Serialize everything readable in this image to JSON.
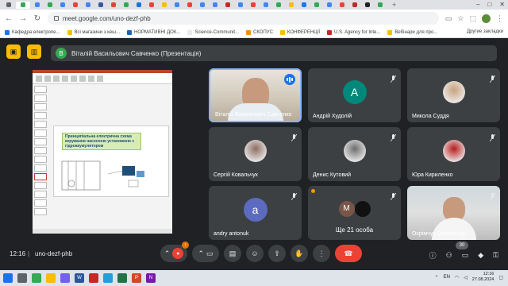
{
  "browser": {
    "url": "meet.google.com/uno-dezf-phb",
    "tab_colors": [
      "#5f6368",
      "#34a853",
      "#4285f4",
      "#34a853",
      "#4285f4",
      "#ea4335",
      "#4285f4",
      "#3b5998",
      "#ea4335",
      "#34a853",
      "#1a73e8",
      "#ea4335",
      "#fbbc04",
      "#4285f4",
      "#ea4335",
      "#4285f4",
      "#4285f4",
      "#c62828",
      "#4285f4",
      "#ea4335",
      "#4285f4",
      "#34a853",
      "#fbbc04",
      "#1877f2",
      "#34a853",
      "#4285f4",
      "#ea4335",
      "#c62828",
      "#202124",
      "#34a853"
    ],
    "tab_new": "+",
    "win_controls": [
      "–",
      "□",
      "✕"
    ],
    "bookmarks": [
      {
        "label": "Кафедра електропе...",
        "color": "#1a73e8"
      },
      {
        "label": "Всі магазини з кеш...",
        "color": "#fbbc04"
      },
      {
        "label": "НОРМАТИВНІ ДОК...",
        "color": "#1565c0"
      },
      {
        "label": "Science-Communit...",
        "color": "#e8eaed"
      },
      {
        "label": "СКОПУС",
        "color": "#ff8f00"
      },
      {
        "label": "КОНФЕРЕНЦІЇ",
        "color": "#fbbc04"
      },
      {
        "label": "U.S. Agency for Inte...",
        "color": "#c62828"
      },
      {
        "label": "Вебінари для про...",
        "color": "#fbbc04"
      }
    ],
    "bookmarks_other": "Другие закладки"
  },
  "meet": {
    "presenter_bar": "Віталій Васильович Савченко (Презентація)",
    "presenter_initial": "В",
    "slide_title": "Принципіальна електрична схема керування насосною установкою з гідроакумулятором",
    "tiles": [
      {
        "name": "Віталій Васильович Савченко",
        "type": "video",
        "active": true
      },
      {
        "name": "Андрій Худолій",
        "type": "letter",
        "initial": "A",
        "color": "#00897b"
      },
      {
        "name": "Микола Суддя",
        "type": "photo",
        "color": "#c9a27e"
      },
      {
        "name": "Сергій Ковальчук",
        "type": "photo",
        "color": "#8d6e63"
      },
      {
        "name": "Денис Кутовий",
        "type": "photo",
        "color": "#6d6d6d"
      },
      {
        "name": "Юра Кириленко",
        "type": "photo",
        "color": "#b71c1c"
      },
      {
        "name": "andry antonuk",
        "type": "letter",
        "initial": "a",
        "color": "#5c6bc0"
      },
      {
        "name": "Ще 21 особа",
        "type": "more",
        "initial": "M",
        "color": "#795548"
      },
      {
        "name": "Охрімчук Олександр",
        "type": "video",
        "active": false
      }
    ],
    "clock": "12:16",
    "separator": "|",
    "meeting_code": "uno-dezf-phb",
    "participant_count": "30",
    "mic_badge": "!",
    "controls": [
      "⌃",
      "🎤",
      "⌃",
      "⏺",
      "CC",
      "☺",
      "⬆",
      "✋",
      "⋮",
      "☎"
    ],
    "right_controls": [
      "ⓘ",
      "👥",
      "💬",
      "◆",
      "🔒"
    ]
  },
  "taskbar": {
    "icons": [
      {
        "name": "windows-start",
        "color": "#1a73e8",
        "label": ""
      },
      {
        "name": "search",
        "color": "#5f6368",
        "label": ""
      },
      {
        "name": "chrome",
        "color": "#34a853",
        "label": ""
      },
      {
        "name": "files",
        "color": "#fbbc04",
        "label": ""
      },
      {
        "name": "viber",
        "color": "#7360f2",
        "label": ""
      },
      {
        "name": "word",
        "color": "#2b579a",
        "label": "W"
      },
      {
        "name": "total-commander",
        "color": "#c62828",
        "label": ""
      },
      {
        "name": "telegram",
        "color": "#229ed9",
        "label": ""
      },
      {
        "name": "excel",
        "color": "#217346",
        "label": ""
      },
      {
        "name": "powerpoint",
        "color": "#d24726",
        "label": "P"
      },
      {
        "name": "onenote",
        "color": "#7719aa",
        "label": "N"
      }
    ],
    "lang": "EN",
    "time": "12:16",
    "date": "27.08.2024"
  }
}
